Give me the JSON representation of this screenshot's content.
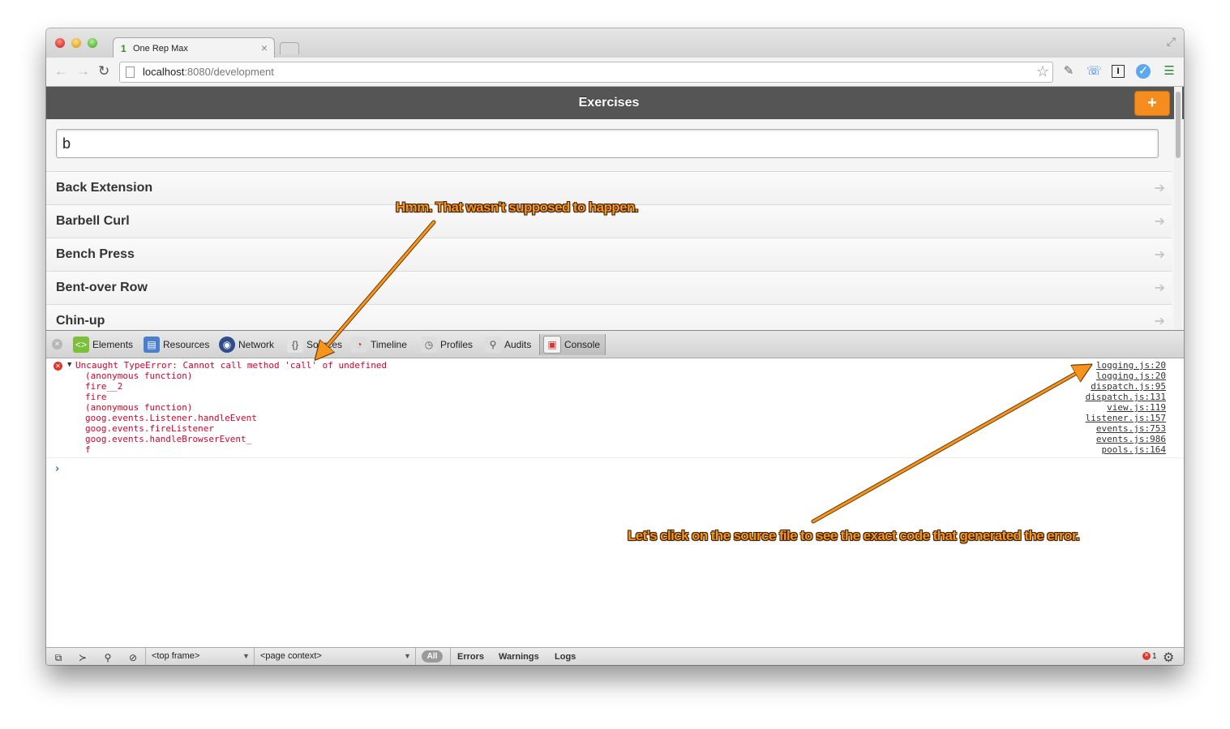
{
  "browser": {
    "tab_title": "One Rep Max",
    "tab_favicon": "1",
    "tab_close": "×",
    "url_host": "localhost",
    "url_path": ":8080/development",
    "star_icon": "☆"
  },
  "app": {
    "title": "Exercises",
    "add_label": "+",
    "search_value": "b",
    "arrow_glyph": "➔",
    "exercises": [
      "Back Extension",
      "Barbell Curl",
      "Bench Press",
      "Bent-over Row",
      "Chin-up"
    ]
  },
  "devtools": {
    "tabs": [
      "Elements",
      "Resources",
      "Network",
      "Sources",
      "Timeline",
      "Profiles",
      "Audits",
      "Console"
    ],
    "active_tab": "Console",
    "error": {
      "message": "Uncaught TypeError: Cannot call method 'call' of undefined",
      "stack": [
        {
          "fn": "",
          "src": "logging.js:20"
        },
        {
          "fn": "(anonymous function)",
          "src": "logging.js:20"
        },
        {
          "fn": "fire__2",
          "src": "dispatch.js:95"
        },
        {
          "fn": "fire",
          "src": "dispatch.js:131"
        },
        {
          "fn": "(anonymous function)",
          "src": "view.js:119"
        },
        {
          "fn": "goog.events.Listener.handleEvent",
          "src": "listener.js:157"
        },
        {
          "fn": "goog.events.fireListener",
          "src": "events.js:753"
        },
        {
          "fn": "goog.events.handleBrowserEvent_",
          "src": "events.js:986"
        },
        {
          "fn": "f",
          "src": "pools.js:164"
        }
      ]
    },
    "prompt": "›",
    "status": {
      "frame_select": "<top frame>",
      "context_select": "<page context>",
      "filters": [
        "All",
        "Errors",
        "Warnings",
        "Logs"
      ],
      "error_count": "1"
    }
  },
  "annotations": {
    "top": "Hmm. That wasn't supposed to happen.",
    "bottom": "Let's click on the source file to see the exact code that generated the error."
  },
  "colors": {
    "accent": "#f48c1e",
    "header": "#555555",
    "error_text": "#d8002a",
    "annotation": "#f7941d"
  }
}
